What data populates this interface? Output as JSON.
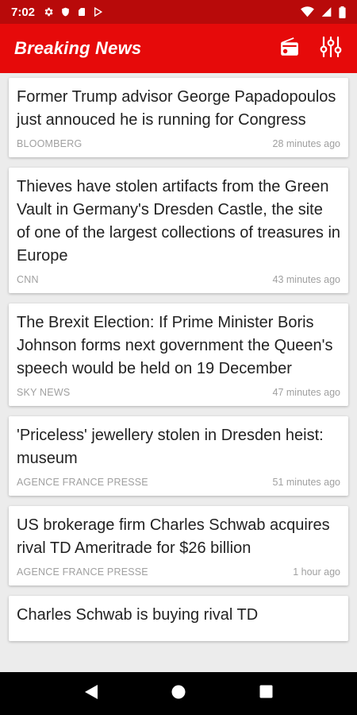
{
  "status_bar": {
    "time": "7:02",
    "left_icons": [
      "gear-icon",
      "shield-icon",
      "sd-card-icon",
      "play-store-icon"
    ],
    "right_icons": [
      "wifi-icon",
      "signal-icon",
      "battery-icon"
    ]
  },
  "app_bar": {
    "title": "Breaking News",
    "actions": [
      "radio-icon",
      "equalizer-settings-icon"
    ],
    "color": "#e60a0a"
  },
  "articles": [
    {
      "headline": "Former Trump advisor George Papadopoulos just annouced he is running for Congress",
      "source": "BLOOMBERG",
      "time": "28 minutes ago"
    },
    {
      "headline": "Thieves have stolen artifacts from the Green Vault in Germany's Dresden Castle, the site of one of the largest collections of treasures in Europe",
      "source": "CNN",
      "time": "43 minutes ago"
    },
    {
      "headline": "The Brexit Election: If Prime Minister Boris Johnson forms next government the Queen's speech would be held on 19 December",
      "source": "SKY NEWS",
      "time": "47 minutes ago"
    },
    {
      "headline": "'Priceless' jewellery stolen in Dresden heist: museum",
      "source": "AGENCE FRANCE PRESSE",
      "time": "51 minutes ago"
    },
    {
      "headline": "US brokerage firm Charles Schwab acquires rival TD Ameritrade for $26 billion",
      "source": "AGENCE FRANCE PRESSE",
      "time": "1 hour ago"
    },
    {
      "headline": "Charles Schwab is buying rival TD",
      "source": "",
      "time": ""
    }
  ],
  "nav_bar": [
    "back-icon",
    "home-icon",
    "recents-icon"
  ]
}
